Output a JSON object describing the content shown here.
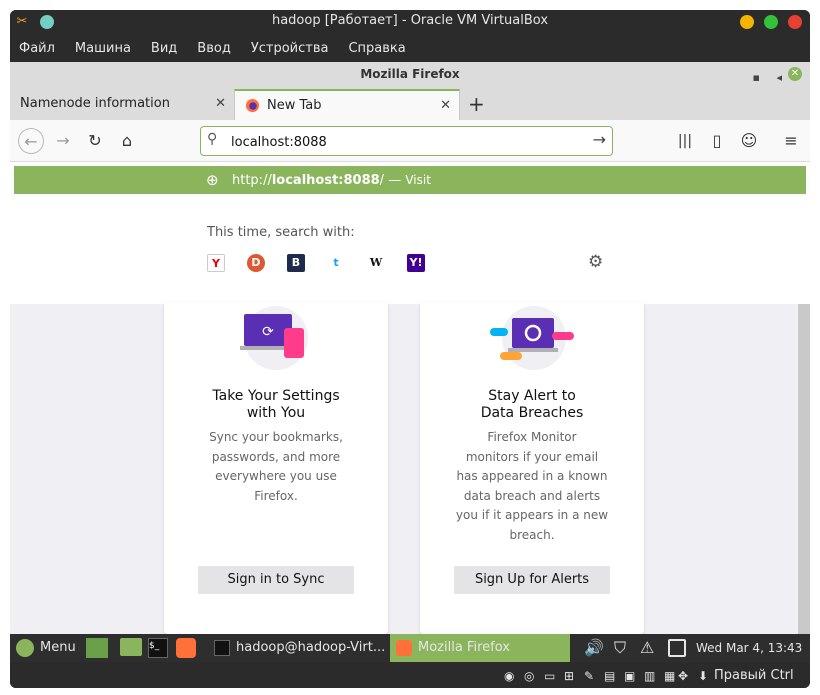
{
  "vbox": {
    "title": "hadoop [Работает] - Oracle VM VirtualBox",
    "menu": [
      "Файл",
      "Машина",
      "Вид",
      "Ввод",
      "Устройства",
      "Справка"
    ]
  },
  "firefox": {
    "window_title": "Mozilla Firefox",
    "tabs": [
      {
        "label": "Namenode information"
      },
      {
        "label": "New Tab"
      }
    ],
    "url_value": "localhost:8088",
    "suggestion": {
      "url_prefix": "http://",
      "url_host": "localhost:8088",
      "url_suffix": "/",
      "separator": "—",
      "action": "Visit"
    },
    "search_with_label": "This time, search with:",
    "engines": [
      "Y",
      "D",
      "B",
      "t",
      "W",
      "Y!"
    ]
  },
  "cards": [
    {
      "title_line1": "Take Your Settings",
      "title_line2": "with You",
      "desc": [
        "Sync your bookmarks,",
        "passwords, and more",
        "everywhere you use",
        "Firefox."
      ],
      "button": "Sign in to Sync"
    },
    {
      "title_line1": "Stay Alert to",
      "title_line2": "Data Breaches",
      "desc": [
        "Firefox Monitor",
        "monitors if your email",
        "has appeared in a known",
        "data breach and alerts",
        "you if it appears in a new",
        "breach."
      ],
      "button": "Sign Up for Alerts"
    }
  ],
  "taskbar": {
    "menu_label": "Menu",
    "terminal_window": "hadoop@hadoop-Virt...",
    "firefox_window": "Mozilla Firefox",
    "clock": "Wed Mar  4, 13:43"
  },
  "status": {
    "host_key": "Правый Ctrl"
  },
  "colors": {
    "accent": "#8ab55d",
    "vbox_bg": "#2b2b2b",
    "content_bg": "#f0f0f4"
  }
}
